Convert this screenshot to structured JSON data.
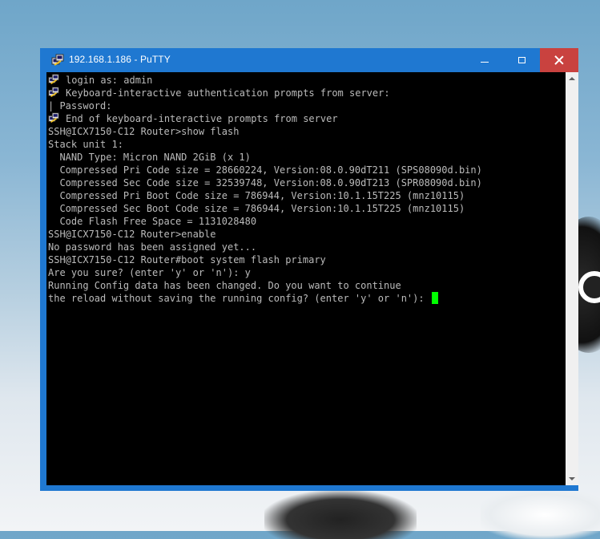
{
  "window": {
    "title": "192.168.1.186 - PuTTY",
    "titlebar_color": "#1f78d1",
    "close_color": "#c9423f",
    "icon": "putty-icon"
  },
  "terminal": {
    "background": "#000000",
    "text_color": "#bbbbbb",
    "cursor_color": "#00ff00",
    "lines": [
      {
        "icon": true,
        "text": "login as: admin"
      },
      {
        "icon": true,
        "text": "Keyboard-interactive authentication prompts from server:"
      },
      {
        "icon": false,
        "text": "| Password:"
      },
      {
        "icon": true,
        "text": "End of keyboard-interactive prompts from server"
      },
      {
        "icon": false,
        "text": "SSH@ICX7150-C12 Router>show flash"
      },
      {
        "icon": false,
        "text": "Stack unit 1:"
      },
      {
        "icon": false,
        "text": "  NAND Type: Micron NAND 2GiB (x 1)"
      },
      {
        "icon": false,
        "text": "  Compressed Pri Code size = 28660224, Version:08.0.90dT211 (SPS08090d.bin)"
      },
      {
        "icon": false,
        "text": "  Compressed Sec Code size = 32539748, Version:08.0.90dT213 (SPR08090d.bin)"
      },
      {
        "icon": false,
        "text": "  Compressed Pri Boot Code size = 786944, Version:10.1.15T225 (mnz10115)"
      },
      {
        "icon": false,
        "text": "  Compressed Sec Boot Code size = 786944, Version:10.1.15T225 (mnz10115)"
      },
      {
        "icon": false,
        "text": "  Code Flash Free Space = 1131028480"
      },
      {
        "icon": false,
        "text": "SSH@ICX7150-C12 Router>enable"
      },
      {
        "icon": false,
        "text": "No password has been assigned yet..."
      },
      {
        "icon": false,
        "text": "SSH@ICX7150-C12 Router#boot system flash primary"
      },
      {
        "icon": false,
        "text": "Are you sure? (enter 'y' or 'n'): y"
      },
      {
        "icon": false,
        "text": "Running Config data has been changed. Do you want to continue"
      },
      {
        "icon": false,
        "text": "the reload without saving the running config? (enter 'y' or 'n'): ",
        "cursor": true
      }
    ]
  }
}
